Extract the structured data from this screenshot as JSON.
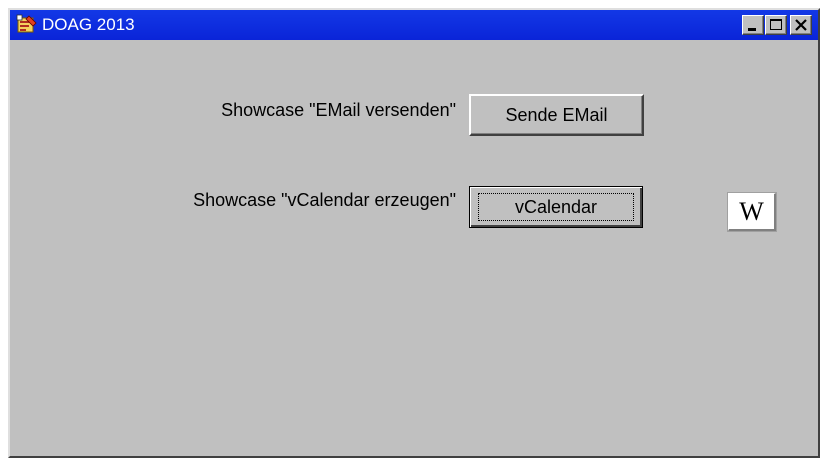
{
  "window": {
    "title": "DOAG 2013",
    "icon": "app-form-icon",
    "controls": {
      "minimize_icon": "minimize-icon",
      "maximize_icon": "maximize-icon",
      "close_icon": "close-icon"
    }
  },
  "content": {
    "email_row": {
      "label": "Showcase \"EMail versenden\"",
      "button_label": "Sende EMail"
    },
    "vcal_row": {
      "label": "Showcase \"vCalendar erzeugen\"",
      "button_label": "vCalendar"
    },
    "wiki_button": {
      "label": "W",
      "icon": "wikipedia-icon"
    }
  },
  "colors": {
    "titlebar": "#0a24d8",
    "window_bg": "#c0c0c0",
    "title_text": "#ffffff"
  }
}
